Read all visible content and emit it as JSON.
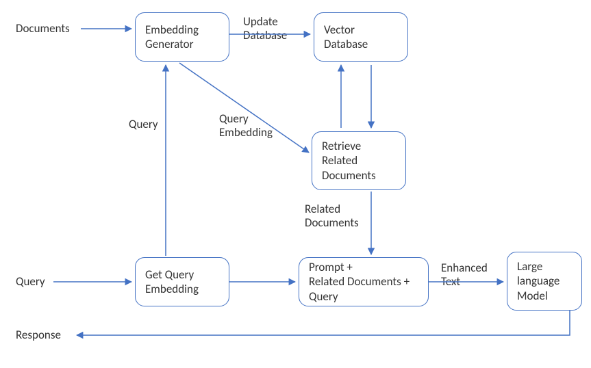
{
  "inputs": {
    "documents": "Documents",
    "query": "Query",
    "response": "Response"
  },
  "nodes": {
    "embedding_generator": "Embedding\nGenerator",
    "vector_database": "Vector\nDatabase",
    "retrieve_related": "Retrieve\nRelated\nDocuments",
    "get_query_embedding": "Get Query\nEmbedding",
    "prompt": "Prompt +\nRelated Documents +\nQuery",
    "llm": "Large\nlanguage\nModel"
  },
  "edges": {
    "update_database": "Update\nDatabase",
    "query": "Query",
    "query_embedding": "Query\nEmbedding",
    "related_documents": "Related\nDocuments",
    "enhanced_text": "Enhanced\nText"
  }
}
